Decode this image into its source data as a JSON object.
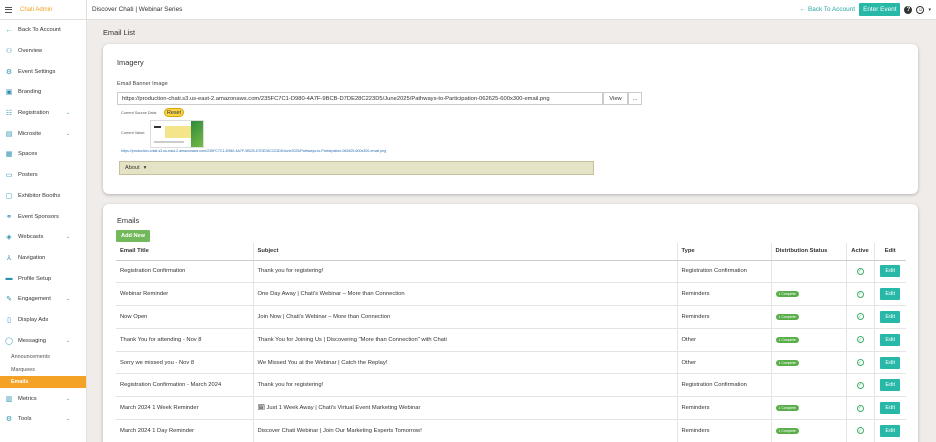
{
  "app": {
    "brand": "Chati Admin",
    "breadcrumb": "Discover Chati | Webinar Series",
    "back_to_account": "Back To Account",
    "enter_event": "Enter Event"
  },
  "sidebar": {
    "items": [
      {
        "label": "Back To Account",
        "icon": "arrow-left-icon",
        "glyph": "←",
        "chevron": false
      },
      {
        "label": "Overview",
        "icon": "network-icon",
        "glyph": "⚇",
        "chevron": false
      },
      {
        "label": "Event Settings",
        "icon": "gears-icon",
        "glyph": "⚙",
        "chevron": false
      },
      {
        "label": "Branding",
        "icon": "image-icon",
        "glyph": "▣",
        "chevron": false
      },
      {
        "label": "Registration",
        "icon": "registration-icon",
        "glyph": "☷",
        "chevron": true
      },
      {
        "label": "Microsite",
        "icon": "microsite-icon",
        "glyph": "▤",
        "chevron": true
      },
      {
        "label": "Spaces",
        "icon": "grid-icon",
        "glyph": "▦",
        "chevron": false
      },
      {
        "label": "Posters",
        "icon": "poster-icon",
        "glyph": "▭",
        "chevron": false
      },
      {
        "label": "Exhibitor Booths",
        "icon": "booth-icon",
        "glyph": "▢",
        "chevron": false
      },
      {
        "label": "Event Sponsors",
        "icon": "sponsors-icon",
        "glyph": "⚭",
        "chevron": false
      },
      {
        "label": "Webcasts",
        "icon": "webcast-icon",
        "glyph": "◈",
        "chevron": true
      },
      {
        "label": "Navigation",
        "icon": "navigation-icon",
        "glyph": "⅄",
        "chevron": false
      },
      {
        "label": "Profile Setup",
        "icon": "profile-card-icon",
        "glyph": "▬",
        "chevron": false
      },
      {
        "label": "Engagement",
        "icon": "engagement-icon",
        "glyph": "✎",
        "chevron": true
      },
      {
        "label": "Display Ads",
        "icon": "display-ads-icon",
        "glyph": "▯",
        "chevron": false
      },
      {
        "label": "Messaging",
        "icon": "chat-icon",
        "glyph": "◯",
        "chevron": true
      }
    ],
    "sub_items": [
      {
        "label": "Announcements",
        "active": false
      },
      {
        "label": "Marquees",
        "active": false
      },
      {
        "label": "Emails",
        "active": true
      }
    ],
    "bottom_items": [
      {
        "label": "Metrics",
        "icon": "metrics-icon",
        "glyph": "▥",
        "chevron": true
      },
      {
        "label": "Tools",
        "icon": "tools-icon",
        "glyph": "⚙",
        "chevron": true
      }
    ]
  },
  "page": {
    "title": "Email List"
  },
  "imagery": {
    "title": "Imagery",
    "field_label": "Email Banner Image",
    "url": "https://production-chati.s3.us-east-2.amazonaws.com/235FC7C1-D980-4A7F-9BCB-D7DE28C223D5/June2025/Pathways-to-Participation-062625-600x300-email.png",
    "view_label": "View",
    "dots_label": "...",
    "current_source_label": "Current Source Data:",
    "reset_label": "Reset",
    "current_value_label": "Current Value:",
    "small_url": "https://production-chati.s3.us-east-2.amazonaws.com/235FC7C1-D980-4A7F-9BCB-D7DE28C223D5/June2025/Pathways-to-Participation-062625-600x300-email.png",
    "about_label": "About"
  },
  "emails": {
    "title": "Emails",
    "add_new": "Add New",
    "columns": [
      "Email Title",
      "Subject",
      "Type",
      "Distribution Status",
      "Active",
      "Edit"
    ],
    "edit_label": "Edit",
    "rows": [
      {
        "title": "Registration Confirmation",
        "subject": "Thank you for registering!",
        "type": "Registration Confirmation",
        "status": ""
      },
      {
        "title": "Webinar Reminder",
        "subject": "One Day Away | Chati's Webinar – More than Connection",
        "type": "Reminders",
        "status": "1 Complete"
      },
      {
        "title": "Now Open",
        "subject": "Join Now | Chati's Webinar – More than Connection",
        "type": "Reminders",
        "status": "1 Complete"
      },
      {
        "title": "Thank You for attending - Nov 8",
        "subject": "Thank You for Joining Us | Discovering \"More than Connection\" with Chati",
        "type": "Other",
        "status": "1 Complete"
      },
      {
        "title": "Sorry we missed you - Nov 8",
        "subject": "We Missed You at the Webinar | Catch the Replay!",
        "type": "Other",
        "status": "1 Complete"
      },
      {
        "title": "Registration Confirmation - March 2024",
        "subject": "Thank you for registering!",
        "type": "Registration Confirmation",
        "status": ""
      },
      {
        "title": "March 2024 1 Week Reminder",
        "subject": "🗓 Just 1 Week Away | Chati's Virtual Event Marketing Webinar",
        "type": "Reminders",
        "status": "1 Complete"
      },
      {
        "title": "March 2024 1 Day Reminder",
        "subject": "Discover Chati Webinar | Join Our Marketing Experts Tomorrow!",
        "type": "Reminders",
        "status": "1 Complete"
      }
    ]
  }
}
